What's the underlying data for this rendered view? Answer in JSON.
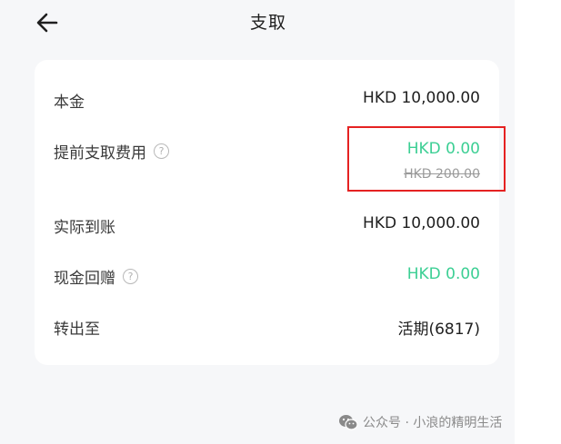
{
  "header": {
    "title": "支取",
    "back_icon": "arrow-left-icon"
  },
  "details": [
    {
      "label": "本金",
      "value": "HKD 10,000.00",
      "help": false,
      "value_color": "#1f1f1f"
    },
    {
      "label": "提前支取费用",
      "value": "HKD 0.00",
      "original_value": "HKD 200.00",
      "help": true,
      "value_color": "#3ccf94"
    },
    {
      "label": "实际到账",
      "value": "HKD 10,000.00",
      "help": false,
      "value_color": "#1f1f1f"
    },
    {
      "label": "现金回赠",
      "value": "HKD 0.00",
      "help": true,
      "value_color": "#3ccf94"
    },
    {
      "label": "转出至",
      "value": "活期(6817)",
      "help": false,
      "value_color": "#1f1f1f"
    }
  ],
  "help_icon_glyph": "?",
  "watermark": {
    "text": "公众号 · 小浪的精明生活",
    "icon": "wechat-icon"
  },
  "colors": {
    "accent_green": "#3ccf94",
    "highlight_red": "#e52222",
    "background": "#f6f7f9"
  }
}
